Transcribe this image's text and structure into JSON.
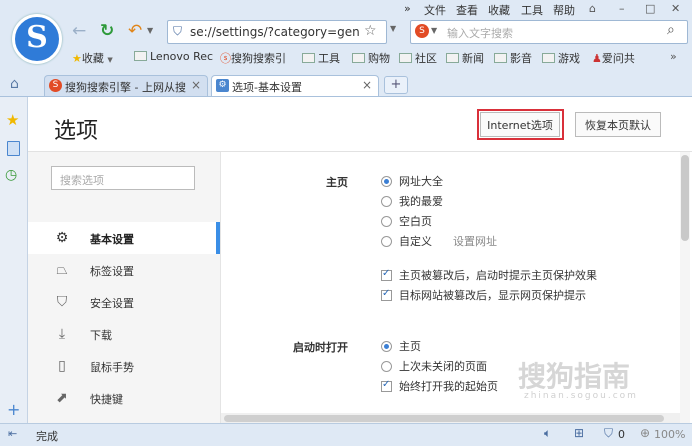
{
  "menubar": {
    "items": [
      "»",
      "文件",
      "查看",
      "收藏",
      "工具",
      "帮助"
    ]
  },
  "nav": {
    "url": "se://settings/?category=gen",
    "search_placeholder": "输入文字搜索",
    "logo": "S"
  },
  "bookmarks": [
    "收藏",
    "Lenovo Rec",
    "搜狗搜索引",
    "工具",
    "购物",
    "社区",
    "新闻",
    "影音",
    "游戏",
    "爱问共"
  ],
  "tabs": [
    {
      "label": "搜狗搜索引擎 - 上网从搜",
      "active": false
    },
    {
      "label": "选项-基本设置",
      "active": true
    }
  ],
  "page": {
    "title": "选项",
    "internet_options": "Internet选项",
    "restore_defaults": "恢复本页默认"
  },
  "leftnav": {
    "search_placeholder": "搜索选项",
    "items": [
      {
        "label": "基本设置",
        "icon": "gear-icon",
        "active": true
      },
      {
        "label": "标签设置",
        "icon": "tab-icon"
      },
      {
        "label": "安全设置",
        "icon": "shield-icon"
      },
      {
        "label": "下载",
        "icon": "download-icon"
      },
      {
        "label": "鼠标手势",
        "icon": "mouse-icon"
      },
      {
        "label": "快捷键",
        "icon": "shortcut-icon"
      }
    ]
  },
  "settings": {
    "homepage": {
      "label": "主页",
      "options": [
        "网址大全",
        "我的最爱",
        "空白页",
        "自定义"
      ],
      "selected": "网址大全",
      "custom_link": "设置网址",
      "checks": [
        "主页被篡改后，启动时提示主页保护效果",
        "目标网站被篡改后，显示网页保护提示"
      ]
    },
    "startup": {
      "label": "启动时打开",
      "options": [
        "主页",
        "上次未关闭的页面"
      ],
      "selected": "主页",
      "check": "始终打开我的起始页"
    }
  },
  "status": {
    "text": "完成",
    "badge": "0",
    "zoom": "100%"
  },
  "watermark": {
    "text": "搜狗指南",
    "sub": "zhinan.sogou.com"
  }
}
